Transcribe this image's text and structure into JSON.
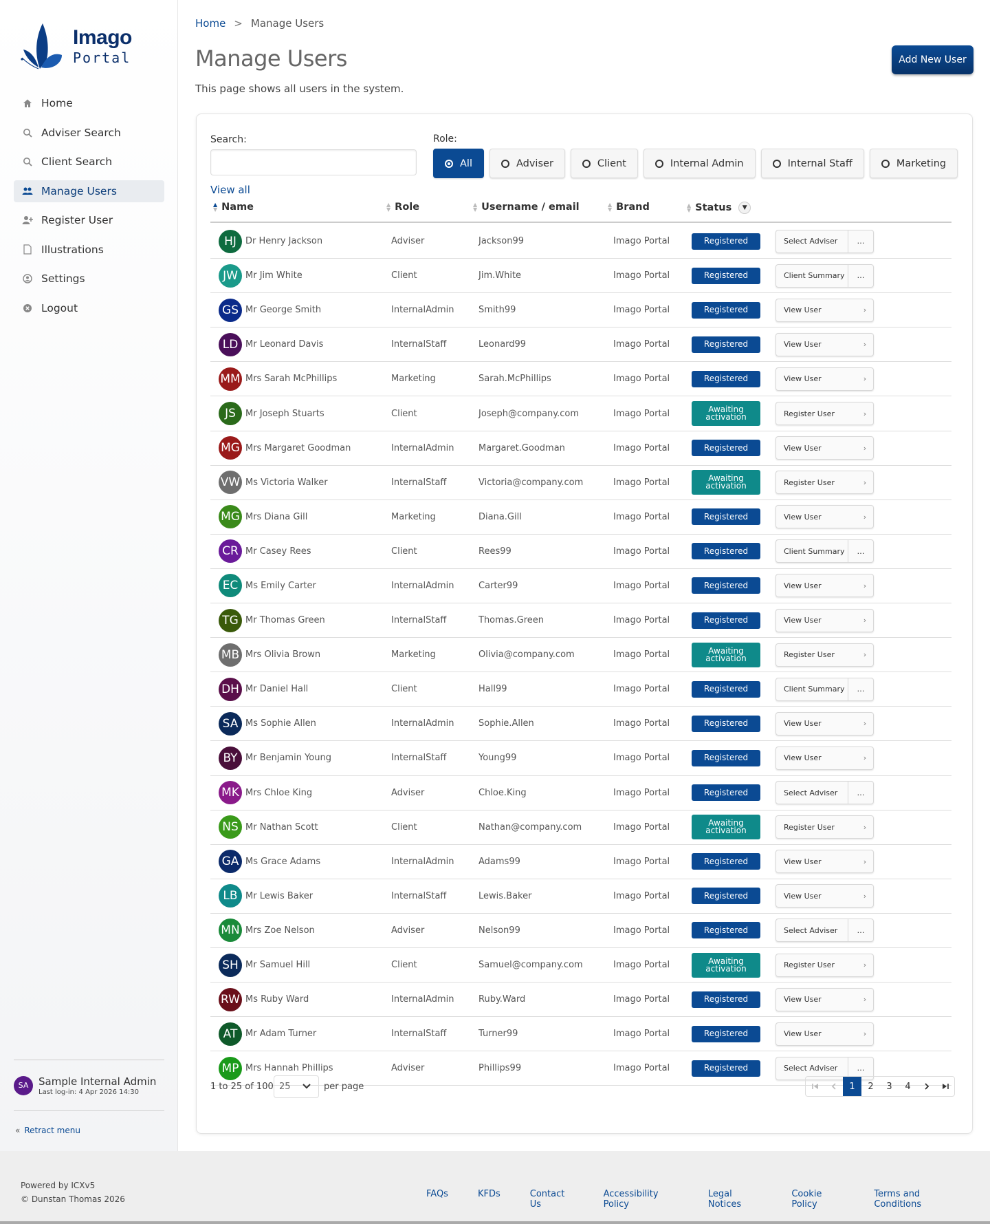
{
  "logo": {
    "line1": "Imago",
    "line2": "Portal"
  },
  "nav": [
    {
      "label": "Home",
      "icon": "home-icon",
      "active": false
    },
    {
      "label": "Adviser Search",
      "icon": "search-icon",
      "active": false
    },
    {
      "label": "Client Search",
      "icon": "search-icon",
      "active": false
    },
    {
      "label": "Manage Users",
      "icon": "users-icon",
      "active": true
    },
    {
      "label": "Register User",
      "icon": "user-add-icon",
      "active": false
    },
    {
      "label": "Illustrations",
      "icon": "document-icon",
      "active": false
    },
    {
      "label": "Settings",
      "icon": "settings-icon",
      "active": false
    },
    {
      "label": "Logout",
      "icon": "logout-icon",
      "active": false
    }
  ],
  "side_user": {
    "initials": "SA",
    "name": "Sample Internal Admin",
    "last_login": "Last log-in: 4 Apr 2026 14:30"
  },
  "retract": "Retract menu",
  "breadcrumb": {
    "home": "Home",
    "sep": ">",
    "current": "Manage Users"
  },
  "page": {
    "title": "Manage Users",
    "description": "This page shows all users in the system.",
    "add_button": "Add New User"
  },
  "filters": {
    "search_label": "Search:",
    "search_value": "",
    "view_all": "View all",
    "role_label": "Role:",
    "roles": [
      "All",
      "Adviser",
      "Client",
      "Internal Admin",
      "Internal Staff",
      "Marketing"
    ],
    "selected_role": "All"
  },
  "table": {
    "headers": [
      "Name",
      "Role",
      "Username / email",
      "Brand",
      "Status"
    ],
    "rows": [
      {
        "initials": "HJ",
        "color": "#0e6b3f",
        "name": "Dr Henry Jackson",
        "role": "Adviser",
        "username": "Jackson99",
        "brand": "Imago Portal",
        "status": "Registered",
        "action": "Select Adviser",
        "type": "more"
      },
      {
        "initials": "JW",
        "color": "#1a9a8a",
        "name": "Mr Jim White",
        "role": "Client",
        "username": "Jim.White",
        "brand": "Imago Portal",
        "status": "Registered",
        "action": "Client Summary",
        "type": "more"
      },
      {
        "initials": "GS",
        "color": "#0a2a8a",
        "name": "Mr George Smith",
        "role": "InternalAdmin",
        "username": "Smith99",
        "brand": "Imago Portal",
        "status": "Registered",
        "action": "View User",
        "type": "chev"
      },
      {
        "initials": "LD",
        "color": "#4a0f5a",
        "name": "Mr Leonard Davis",
        "role": "InternalStaff",
        "username": "Leonard99",
        "brand": "Imago Portal",
        "status": "Registered",
        "action": "View User",
        "type": "chev"
      },
      {
        "initials": "MM",
        "color": "#9a1a1a",
        "name": "Mrs Sarah McPhillips",
        "role": "Marketing",
        "username": "Sarah.McPhillips",
        "brand": "Imago Portal",
        "status": "Registered",
        "action": "View User",
        "type": "chev"
      },
      {
        "initials": "JS",
        "color": "#2a6a1a",
        "name": "Mr Joseph Stuarts",
        "role": "Client",
        "username": "Joseph@company.com",
        "brand": "Imago Portal",
        "status": "Awaiting activation",
        "action": "Register User",
        "type": "chev"
      },
      {
        "initials": "MG",
        "color": "#9a1a1a",
        "name": "Mrs Margaret Goodman",
        "role": "InternalAdmin",
        "username": "Margaret.Goodman",
        "brand": "Imago Portal",
        "status": "Registered",
        "action": "View User",
        "type": "chev"
      },
      {
        "initials": "VW",
        "color": "#6e6e6e",
        "name": "Ms Victoria Walker",
        "role": "InternalStaff",
        "username": "Victoria@company.com",
        "brand": "Imago Portal",
        "status": "Awaiting activation",
        "action": "Register User",
        "type": "chev"
      },
      {
        "initials": "MG",
        "color": "#3a8a1a",
        "name": "Mrs Diana Gill",
        "role": "Marketing",
        "username": "Diana.Gill",
        "brand": "Imago Portal",
        "status": "Registered",
        "action": "View User",
        "type": "chev"
      },
      {
        "initials": "CR",
        "color": "#6a1a9a",
        "name": "Mr Casey Rees",
        "role": "Client",
        "username": "Rees99",
        "brand": "Imago Portal",
        "status": "Registered",
        "action": "Client Summary",
        "type": "more"
      },
      {
        "initials": "EC",
        "color": "#0f8a7a",
        "name": "Ms Emily Carter",
        "role": "InternalAdmin",
        "username": "Carter99",
        "brand": "Imago Portal",
        "status": "Registered",
        "action": "View User",
        "type": "chev"
      },
      {
        "initials": "TG",
        "color": "#3a5a0a",
        "name": "Mr Thomas Green",
        "role": "InternalStaff",
        "username": "Thomas.Green",
        "brand": "Imago Portal",
        "status": "Registered",
        "action": "View User",
        "type": "chev"
      },
      {
        "initials": "MB",
        "color": "#6e6e6e",
        "name": "Mrs Olivia Brown",
        "role": "Marketing",
        "username": "Olivia@company.com",
        "brand": "Imago Portal",
        "status": "Awaiting activation",
        "action": "Register User",
        "type": "chev"
      },
      {
        "initials": "DH",
        "color": "#5a0f4a",
        "name": "Mr Daniel Hall",
        "role": "Client",
        "username": "Hall99",
        "brand": "Imago Portal",
        "status": "Registered",
        "action": "Client Summary",
        "type": "more"
      },
      {
        "initials": "SA",
        "color": "#0b2a5a",
        "name": "Ms Sophie Allen",
        "role": "InternalAdmin",
        "username": "Sophie.Allen",
        "brand": "Imago Portal",
        "status": "Registered",
        "action": "View User",
        "type": "chev"
      },
      {
        "initials": "BY",
        "color": "#4a0f3a",
        "name": "Mr Benjamin Young",
        "role": "InternalStaff",
        "username": "Young99",
        "brand": "Imago Portal",
        "status": "Registered",
        "action": "View User",
        "type": "chev"
      },
      {
        "initials": "MK",
        "color": "#8a1a8a",
        "name": "Mrs Chloe King",
        "role": "Adviser",
        "username": "Chloe.King",
        "brand": "Imago Portal",
        "status": "Registered",
        "action": "Select Adviser",
        "type": "more"
      },
      {
        "initials": "NS",
        "color": "#3a9a1a",
        "name": "Mr Nathan Scott",
        "role": "Client",
        "username": "Nathan@company.com",
        "brand": "Imago Portal",
        "status": "Awaiting activation",
        "action": "Register User",
        "type": "chev"
      },
      {
        "initials": "GA",
        "color": "#0b2a6a",
        "name": "Ms Grace Adams",
        "role": "InternalAdmin",
        "username": "Adams99",
        "brand": "Imago Portal",
        "status": "Registered",
        "action": "View User",
        "type": "chev"
      },
      {
        "initials": "LB",
        "color": "#0f8a8a",
        "name": "Mr Lewis Baker",
        "role": "InternalStaff",
        "username": "Lewis.Baker",
        "brand": "Imago Portal",
        "status": "Registered",
        "action": "View User",
        "type": "chev"
      },
      {
        "initials": "MN",
        "color": "#1a8a3a",
        "name": "Mrs Zoe Nelson",
        "role": "Adviser",
        "username": "Nelson99",
        "brand": "Imago Portal",
        "status": "Registered",
        "action": "Select Adviser",
        "type": "more"
      },
      {
        "initials": "SH",
        "color": "#0b2a5a",
        "name": "Mr Samuel Hill",
        "role": "Client",
        "username": "Samuel@company.com",
        "brand": "Imago Portal",
        "status": "Awaiting activation",
        "action": "Register User",
        "type": "chev"
      },
      {
        "initials": "RW",
        "color": "#6a0f1a",
        "name": "Ms Ruby Ward",
        "role": "InternalAdmin",
        "username": "Ruby.Ward",
        "brand": "Imago Portal",
        "status": "Registered",
        "action": "View User",
        "type": "chev"
      },
      {
        "initials": "AT",
        "color": "#0f5a2a",
        "name": "Mr Adam Turner",
        "role": "InternalStaff",
        "username": "Turner99",
        "brand": "Imago Portal",
        "status": "Registered",
        "action": "View User",
        "type": "chev"
      },
      {
        "initials": "MP",
        "color": "#1a9a1a",
        "name": "Mrs Hannah Phillips",
        "role": "Adviser",
        "username": "Phillips99",
        "brand": "Imago Portal",
        "status": "Registered",
        "action": "Select Adviser",
        "type": "more"
      }
    ]
  },
  "pagination": {
    "info": "1 to 25 of 100",
    "per_page_value": "25",
    "per_page_label": "per page",
    "pages": [
      "1",
      "2",
      "3",
      "4"
    ],
    "current": "1"
  },
  "footer": {
    "powered": "Powered by ICXv5",
    "copyright": "© Dunstan Thomas 2026",
    "links": [
      "FAQs",
      "KFDs",
      "Contact Us",
      "Accessibility Policy",
      "Legal Notices",
      "Cookie Policy",
      "Terms and Conditions"
    ]
  },
  "colors": {
    "primary": "#0b4a93",
    "awaiting": "#0f8a8a",
    "registered": "#0b4a93"
  }
}
